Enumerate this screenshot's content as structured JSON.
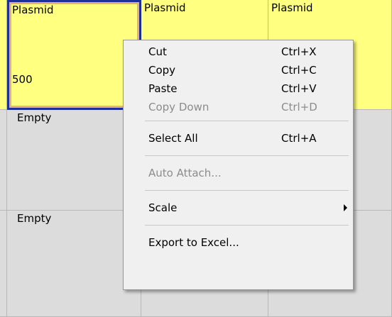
{
  "grid": {
    "row1": [
      "Plasmid",
      "Plasmid",
      "Plasmid"
    ],
    "row1_value": "500",
    "row2_label": "Empty",
    "row3_label": "Empty"
  },
  "menu": {
    "items": [
      {
        "label": "Cut",
        "shortcut": "Ctrl+X",
        "enabled": true
      },
      {
        "label": "Copy",
        "shortcut": "Ctrl+C",
        "enabled": true
      },
      {
        "label": "Paste",
        "shortcut": "Ctrl+V",
        "enabled": true
      },
      {
        "label": "Copy Down",
        "shortcut": "Ctrl+D",
        "enabled": false
      },
      {
        "label": "Select All",
        "shortcut": "Ctrl+A",
        "enabled": true
      },
      {
        "label": "Auto Attach...",
        "shortcut": "",
        "enabled": false
      },
      {
        "label": "Scale",
        "shortcut": "",
        "enabled": true,
        "submenu": true
      },
      {
        "label": "Export to Excel...",
        "shortcut": "",
        "enabled": true
      }
    ]
  },
  "colors": {
    "filled_cell": "#ffff80",
    "empty_cell": "#dcdcdc",
    "selection_border": "#1f2f9a",
    "menu_background": "#f0f0f0",
    "disabled_text": "#8c8c8c"
  }
}
